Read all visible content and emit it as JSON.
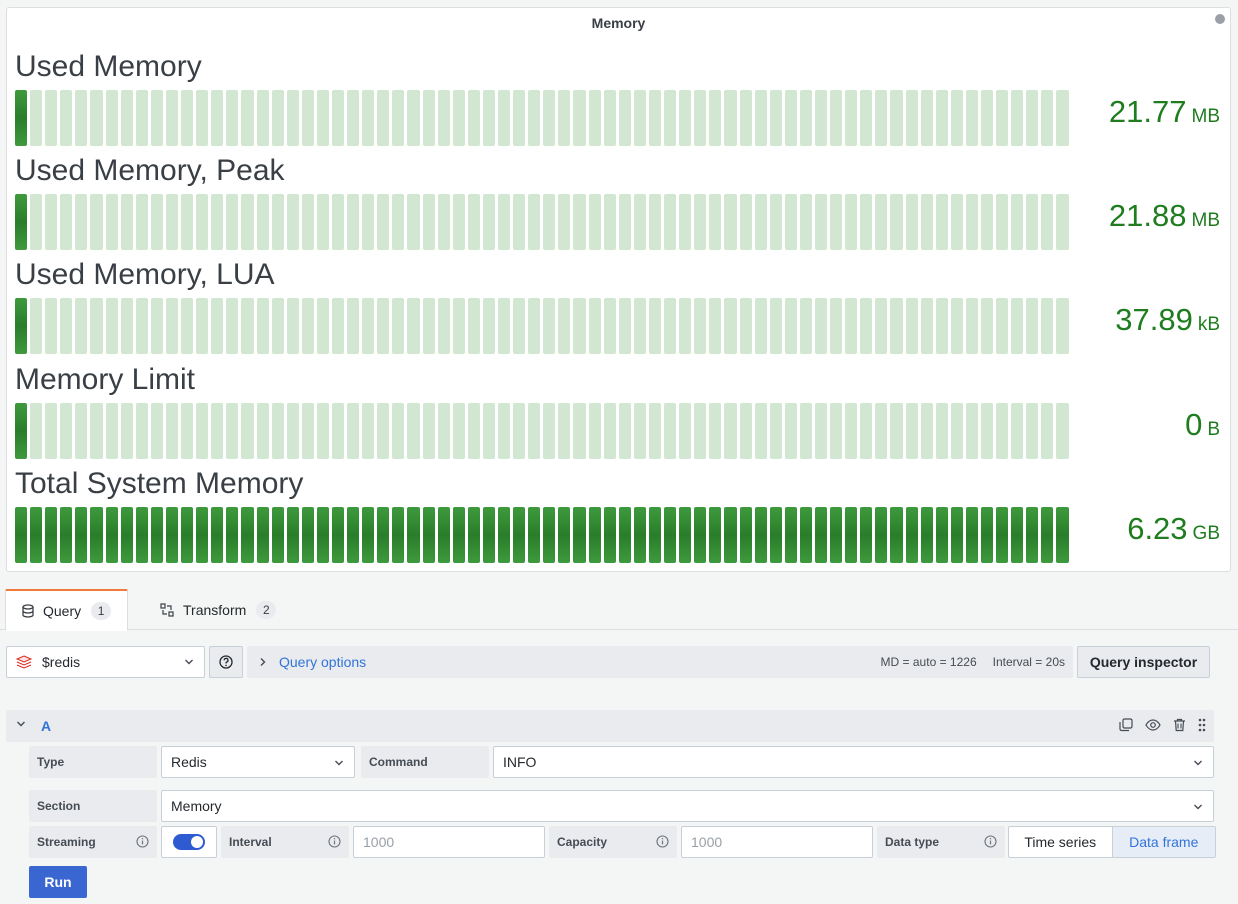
{
  "panel": {
    "title": "Memory",
    "cell_count": 70,
    "gauges": [
      {
        "label": "Used Memory",
        "value": "21.77",
        "unit": "MB",
        "fill_fraction": 0.012
      },
      {
        "label": "Used Memory, Peak",
        "value": "21.88",
        "unit": "MB",
        "fill_fraction": 0.012
      },
      {
        "label": "Used Memory, LUA",
        "value": "37.89",
        "unit": "kB",
        "fill_fraction": 0.012
      },
      {
        "label": "Memory Limit",
        "value": "0",
        "unit": "B",
        "fill_fraction": 0.012
      },
      {
        "label": "Total System Memory",
        "value": "6.23",
        "unit": "GB",
        "fill_fraction": 1.0
      }
    ],
    "colors": {
      "lit": "#2a7d2a",
      "unlit": "#d2e7d1",
      "value": "#1f7d1f"
    }
  },
  "tabs": [
    {
      "label": "Query",
      "count": "1",
      "icon": "database-icon",
      "active": true
    },
    {
      "label": "Transform",
      "count": "2",
      "icon": "transform-icon",
      "active": false
    }
  ],
  "query_row": {
    "datasource": "$redis",
    "query_options_label": "Query options",
    "md": "MD = auto = 1226",
    "interval": "Interval = 20s",
    "inspector_label": "Query inspector"
  },
  "query": {
    "ref": "A",
    "type_label": "Type",
    "type_value": "Redis",
    "command_label": "Command",
    "command_value": "INFO",
    "section_label": "Section",
    "section_value": "Memory",
    "streaming_label": "Streaming",
    "streaming_on": true,
    "interval_label": "Interval",
    "interval_placeholder": "1000",
    "capacity_label": "Capacity",
    "capacity_placeholder": "1000",
    "datatype_label": "Data type",
    "datatype_options": [
      "Time series",
      "Data frame"
    ],
    "datatype_selected": "Data frame",
    "run_label": "Run"
  },
  "accent": "#3274d9"
}
